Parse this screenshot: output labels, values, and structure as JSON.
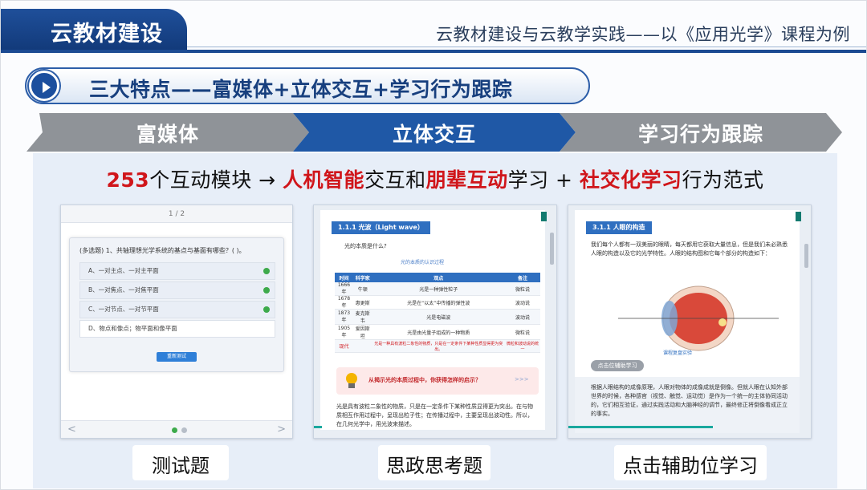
{
  "header": {
    "tab_label": "云教材建设",
    "title": "云教材建设与云教学实践——以《应用光学》课程为例"
  },
  "banner": {
    "icon": "play-icon",
    "text": "三大特点——富媒体+立体交互+学习行为跟踪"
  },
  "chevrons": [
    {
      "label": "富媒体",
      "color": "#8f9398"
    },
    {
      "label": "立体交互",
      "color": "#1f58a6"
    },
    {
      "label": "学习行为跟踪",
      "color": "#8f9398"
    }
  ],
  "tagline": {
    "num": "253",
    "p1": "个互动模块 → ",
    "r1": "人机智能",
    "p2": "交互和",
    "r2": "朋辈互动",
    "p3": "学习 + ",
    "r3": "社交化学习",
    "p4": "行为范式"
  },
  "cards": {
    "quiz": {
      "page": "1 / 2",
      "question": "(多选题) 1、共轴理想光学系统的基点与基面有哪些？(  )。",
      "options": [
        "A、一对主点、一对主平面",
        "B、一对焦点、一对焦平面",
        "C、一对节点、一对节平面",
        "D、物点和像点；物平面和像平面"
      ],
      "button": "重新测试",
      "prev": "<",
      "next": ">",
      "caption": "测试题"
    },
    "ideology": {
      "heading": "1.1.1  光波（Light wave）",
      "intro": "光的本质是什么?",
      "table_title": "光的本质的认识过程",
      "columns": [
        "时间",
        "科学家",
        "观点",
        "备注"
      ],
      "rows": [
        [
          "1666 年",
          "牛顿",
          "光是一种弹性粒子",
          "微粒说"
        ],
        [
          "1678 年",
          "惠更斯",
          "光是在“以太”中传播的弹性波",
          "波动说"
        ],
        [
          "1873 年",
          "麦克斯韦",
          "光是电磁波",
          "波动说"
        ],
        [
          "1905 年",
          "爱因斯坦",
          "光是由光量子组成的一种物质",
          "微粒说"
        ],
        [
          "现代",
          "",
          "光是一种具有波粒二象性的物质，只是在一定条件下某种性质显得更为突出。",
          "微粒和波动说的统一"
        ]
      ],
      "think": "从揭示光的本质过程中，你获得怎样的启示？",
      "think_arrows": ">>>",
      "para": "光是具有波粒二象性的物质，只是在一定条件下某种性质显得更为突出。在与物质相互作用过程中，呈现出粒子性；在传播过程中，主要呈现出波动性。所以，在几何光学中，用光波来描述。",
      "caption": "思政思考题"
    },
    "aux": {
      "heading": "3.1.1  人眼的构造",
      "para1": "我们每个人都有一双美丽的眼睛，每天都用它获取大量信息，但是我们未必熟悉人眼的构造以及它的光学特性。人眼的结构图和它每个部分的构造如下：",
      "button": "点击位辅助学习",
      "link": "课程复盘实验",
      "para2": "根据人眼结构的成像原理，人眼对物体的成像成就是倒像。但就人眼在认知外部世界的时候，各种感官（视觉、触觉、运动觉）是作为一个统一的主体协同活动的，它们相互验证，通过实践活动和大脑神经的调节，最终修正将倒像看成正立的事实。",
      "caption": "点击辅助位学习"
    }
  }
}
